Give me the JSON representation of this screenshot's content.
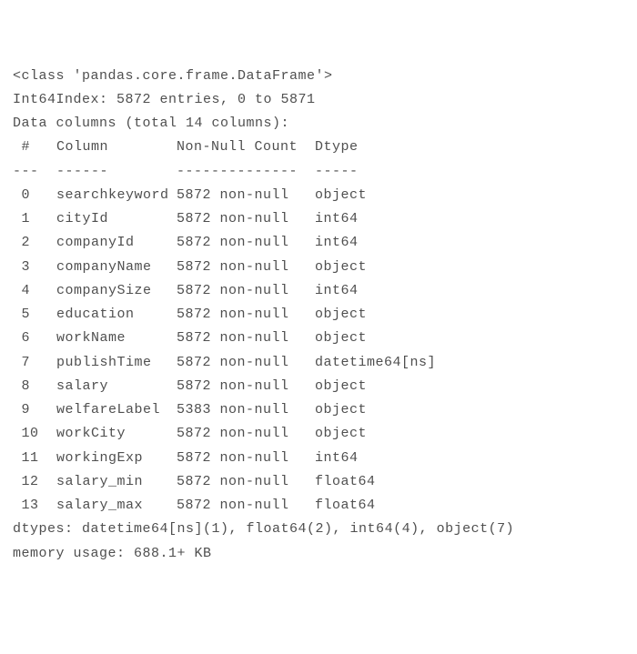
{
  "header": {
    "class_line": "<class 'pandas.core.frame.DataFrame'>",
    "index_line": "Int64Index: 5872 entries, 0 to 5871",
    "columns_line": "Data columns (total 14 columns):"
  },
  "col_header": {
    "idx": " # ",
    "col": "Column",
    "nn": "Non-Null Count",
    "dt": "Dtype"
  },
  "col_rule": {
    "idx": "---",
    "col": "------",
    "nn": "--------------",
    "dt": "-----"
  },
  "rows": [
    {
      "idx": " 0 ",
      "col": "searchkeyword",
      "nn": "5872 non-null",
      "dt": "object"
    },
    {
      "idx": " 1 ",
      "col": "cityId",
      "nn": "5872 non-null",
      "dt": "int64"
    },
    {
      "idx": " 2 ",
      "col": "companyId",
      "nn": "5872 non-null",
      "dt": "int64"
    },
    {
      "idx": " 3 ",
      "col": "companyName",
      "nn": "5872 non-null",
      "dt": "object"
    },
    {
      "idx": " 4 ",
      "col": "companySize",
      "nn": "5872 non-null",
      "dt": "int64"
    },
    {
      "idx": " 5 ",
      "col": "education",
      "nn": "5872 non-null",
      "dt": "object"
    },
    {
      "idx": " 6 ",
      "col": "workName",
      "nn": "5872 non-null",
      "dt": "object"
    },
    {
      "idx": " 7 ",
      "col": "publishTime",
      "nn": "5872 non-null",
      "dt": "datetime64[ns]"
    },
    {
      "idx": " 8 ",
      "col": "salary",
      "nn": "5872 non-null",
      "dt": "object"
    },
    {
      "idx": " 9 ",
      "col": "welfareLabel",
      "nn": "5383 non-null",
      "dt": "object"
    },
    {
      "idx": " 10",
      "col": "workCity",
      "nn": "5872 non-null",
      "dt": "object"
    },
    {
      "idx": " 11",
      "col": "workingExp",
      "nn": "5872 non-null",
      "dt": "int64"
    },
    {
      "idx": " 12",
      "col": "salary_min",
      "nn": "5872 non-null",
      "dt": "float64"
    },
    {
      "idx": " 13",
      "col": "salary_max",
      "nn": "5872 non-null",
      "dt": "float64"
    }
  ],
  "footer": {
    "dtypes_line": "dtypes: datetime64[ns](1), float64(2), int64(4), object(7)",
    "memory_line": "memory usage: 688.1+ KB"
  }
}
